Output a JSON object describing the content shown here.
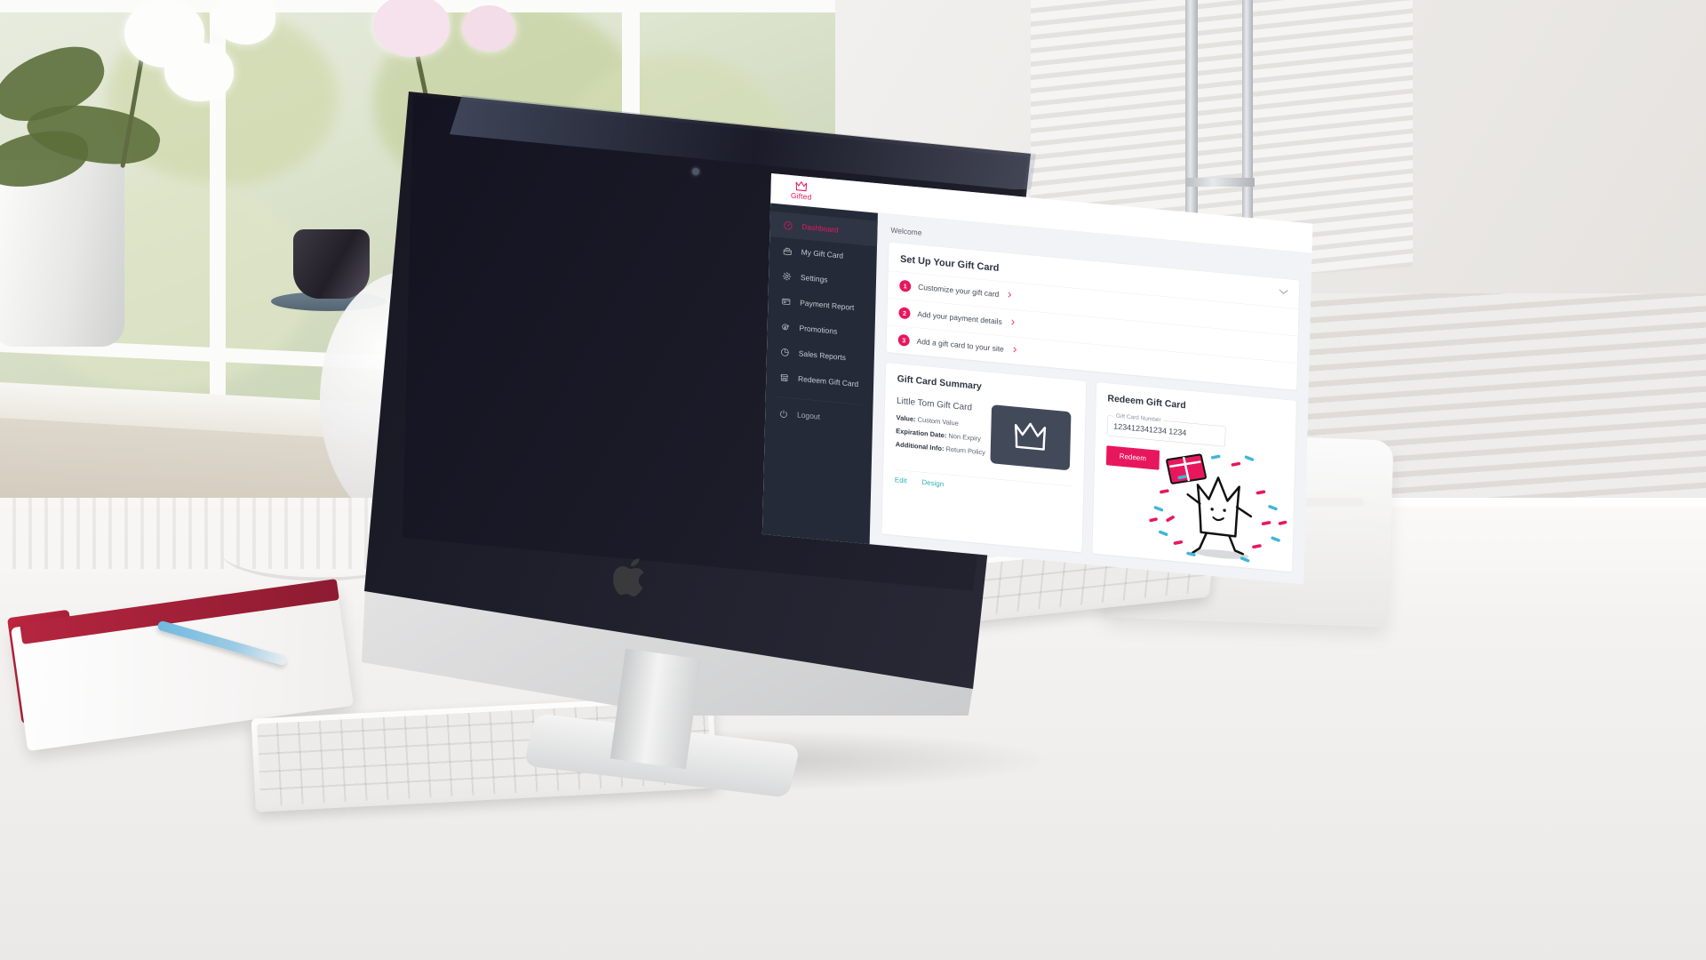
{
  "app": {
    "brand_name": "Gifted",
    "brand_icon": "crown-icon",
    "accent_color": "#e8175d",
    "sidebar_color": "#252a38",
    "link_color": "#2fb0b8"
  },
  "sidebar": {
    "items": [
      {
        "label": "Dashboard",
        "icon": "dashboard-gauge-icon",
        "active": true
      },
      {
        "label": "My Gift Card",
        "icon": "gift-card-icon",
        "active": false
      },
      {
        "label": "Settings",
        "icon": "gear-icon",
        "active": false
      },
      {
        "label": "Payment Report",
        "icon": "payment-card-icon",
        "active": false
      },
      {
        "label": "Promotions",
        "icon": "promotion-tag-icon",
        "active": false
      },
      {
        "label": "Sales Reports",
        "icon": "pie-chart-icon",
        "active": false
      },
      {
        "label": "Redeem Gift Card",
        "icon": "store-icon",
        "active": false
      }
    ],
    "logout": {
      "label": "Logout",
      "icon": "power-icon"
    }
  },
  "content": {
    "welcome": "Welcome",
    "setup": {
      "title": "Set Up Your Gift Card",
      "collapse_icon": "chevron-down-icon",
      "steps": [
        {
          "number": "1",
          "label": "Customize your gift card",
          "arrow": "chevron-right-icon"
        },
        {
          "number": "2",
          "label": "Add your payment details",
          "arrow": "chevron-right-icon"
        },
        {
          "number": "3",
          "label": "Add a gift card to your site",
          "arrow": "chevron-right-icon"
        }
      ]
    },
    "summary": {
      "title": "Gift Card Summary",
      "card_name": "Little Tom Gift Card",
      "rows": [
        {
          "label": "Value:",
          "value": "Custom Value"
        },
        {
          "label": "Expiration Date:",
          "value": "Non Expiry"
        },
        {
          "label": "Additional Info:",
          "value": "Return Policy"
        }
      ],
      "thumbnail_icon": "crown-thumbnail-icon",
      "links": [
        {
          "label": "Edit"
        },
        {
          "label": "Design"
        }
      ]
    },
    "redeem": {
      "title": "Redeem Gift Card",
      "field_label": "Gift Card Number",
      "field_value": "123412341234 1234",
      "field_placeholder": "Gift Card Number",
      "button_label": "Redeem",
      "illustration": "confetti-character-illustration"
    }
  }
}
